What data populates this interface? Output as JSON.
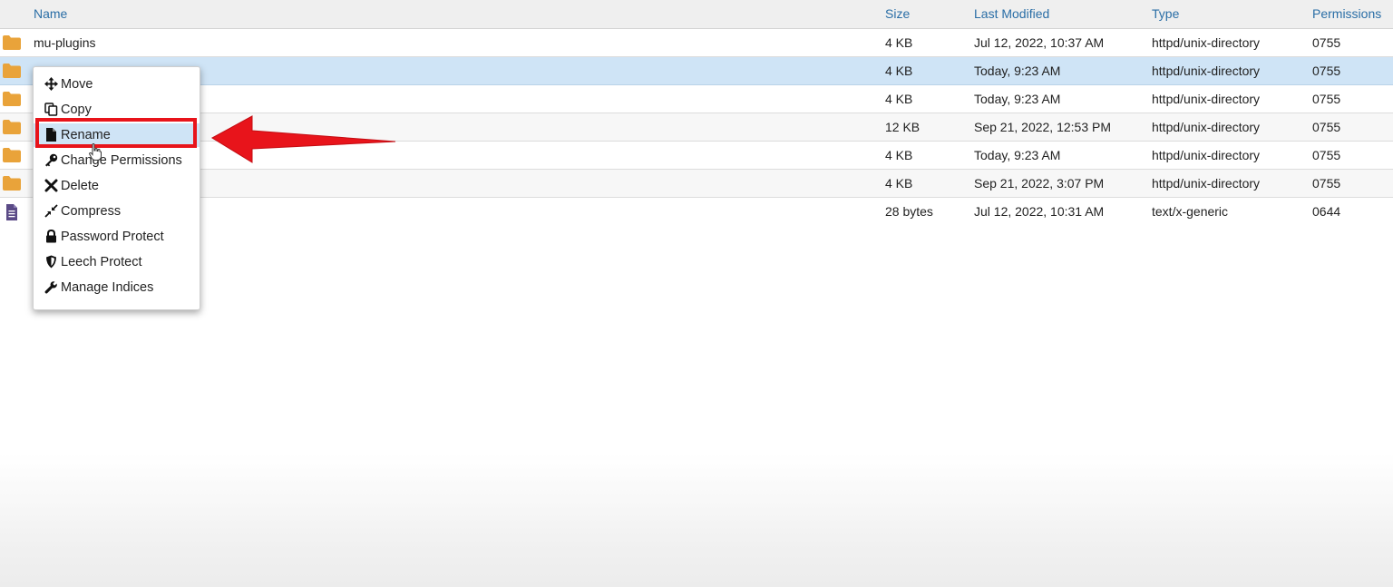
{
  "columns": {
    "name": "Name",
    "size": "Size",
    "modified": "Last Modified",
    "type": "Type",
    "permissions": "Permissions"
  },
  "rows": [
    {
      "icon": "folder-icon",
      "name": "mu-plugins",
      "size": "4 KB",
      "modified": "Jul 12, 2022, 10:37 AM",
      "type": "httpd/unix-directory",
      "permissions": "0755"
    },
    {
      "icon": "folder-icon",
      "name": "",
      "size": "4 KB",
      "modified": "Today, 9:23 AM",
      "type": "httpd/unix-directory",
      "permissions": "0755"
    },
    {
      "icon": "folder-icon",
      "name": "",
      "size": "4 KB",
      "modified": "Today, 9:23 AM",
      "type": "httpd/unix-directory",
      "permissions": "0755"
    },
    {
      "icon": "folder-icon",
      "name": "",
      "size": "12 KB",
      "modified": "Sep 21, 2022, 12:53 PM",
      "type": "httpd/unix-directory",
      "permissions": "0755"
    },
    {
      "icon": "folder-icon",
      "name": "",
      "size": "4 KB",
      "modified": "Today, 9:23 AM",
      "type": "httpd/unix-directory",
      "permissions": "0755"
    },
    {
      "icon": "folder-icon",
      "name": "",
      "size": "4 KB",
      "modified": "Sep 21, 2022, 3:07 PM",
      "type": "httpd/unix-directory",
      "permissions": "0755"
    },
    {
      "icon": "file-icon",
      "name": "",
      "size": "28 bytes",
      "modified": "Jul 12, 2022, 10:31 AM",
      "type": "text/x-generic",
      "permissions": "0644"
    }
  ],
  "context_menu": {
    "items": [
      {
        "icon": "move-icon",
        "label": "Move"
      },
      {
        "icon": "copy-icon",
        "label": "Copy"
      },
      {
        "icon": "file-icon",
        "label": "Rename"
      },
      {
        "icon": "key-icon",
        "label": "Change Permissions"
      },
      {
        "icon": "close-icon",
        "label": "Delete"
      },
      {
        "icon": "compress-icon",
        "label": "Compress"
      },
      {
        "icon": "lock-icon",
        "label": "Password Protect"
      },
      {
        "icon": "shield-icon",
        "label": "Leech Protect"
      },
      {
        "icon": "wrench-icon",
        "label": "Manage Indices"
      }
    ],
    "highlighted_item": "Rename"
  },
  "colors": {
    "header_text": "#2a6ea6",
    "selected_row": "#cfe4f6",
    "folder": "#e9a33a",
    "annotation_red": "#e8141b"
  }
}
